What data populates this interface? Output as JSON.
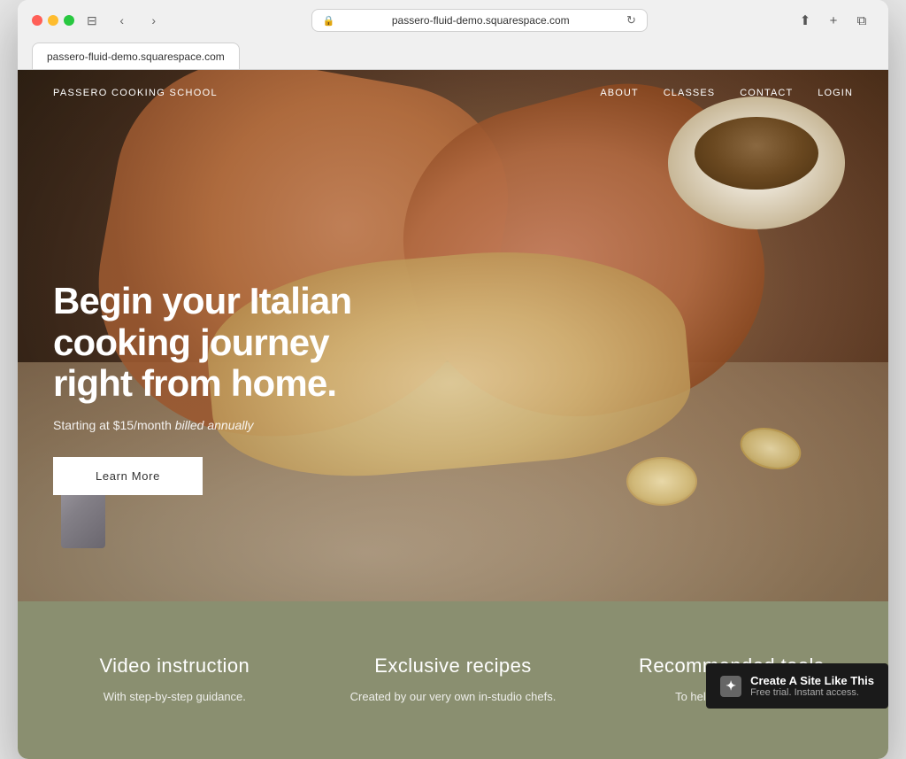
{
  "browser": {
    "url": "passero-fluid-demo.squarespace.com",
    "tab_label": "passero-fluid-demo.squarespace.com"
  },
  "nav": {
    "logo": "PASSERO COOKING SCHOOL",
    "links": [
      "ABOUT",
      "CLASSES",
      "CONTACT",
      "LOGIN"
    ]
  },
  "hero": {
    "title": "Begin your Italian cooking journey right from home.",
    "subtitle_static": "Starting at $15/month ",
    "subtitle_italic": "billed annually",
    "cta": "Learn More"
  },
  "features": [
    {
      "title": "Video instruction",
      "desc": "With step-by-step guidance."
    },
    {
      "title": "Exclusive recipes",
      "desc": "Created by our very own in-studio chefs."
    },
    {
      "title": "Recommended tools",
      "desc": "To help you improve..."
    }
  ],
  "badge": {
    "main": "Create A Site Like This",
    "sub": "Free trial. Instant access."
  }
}
